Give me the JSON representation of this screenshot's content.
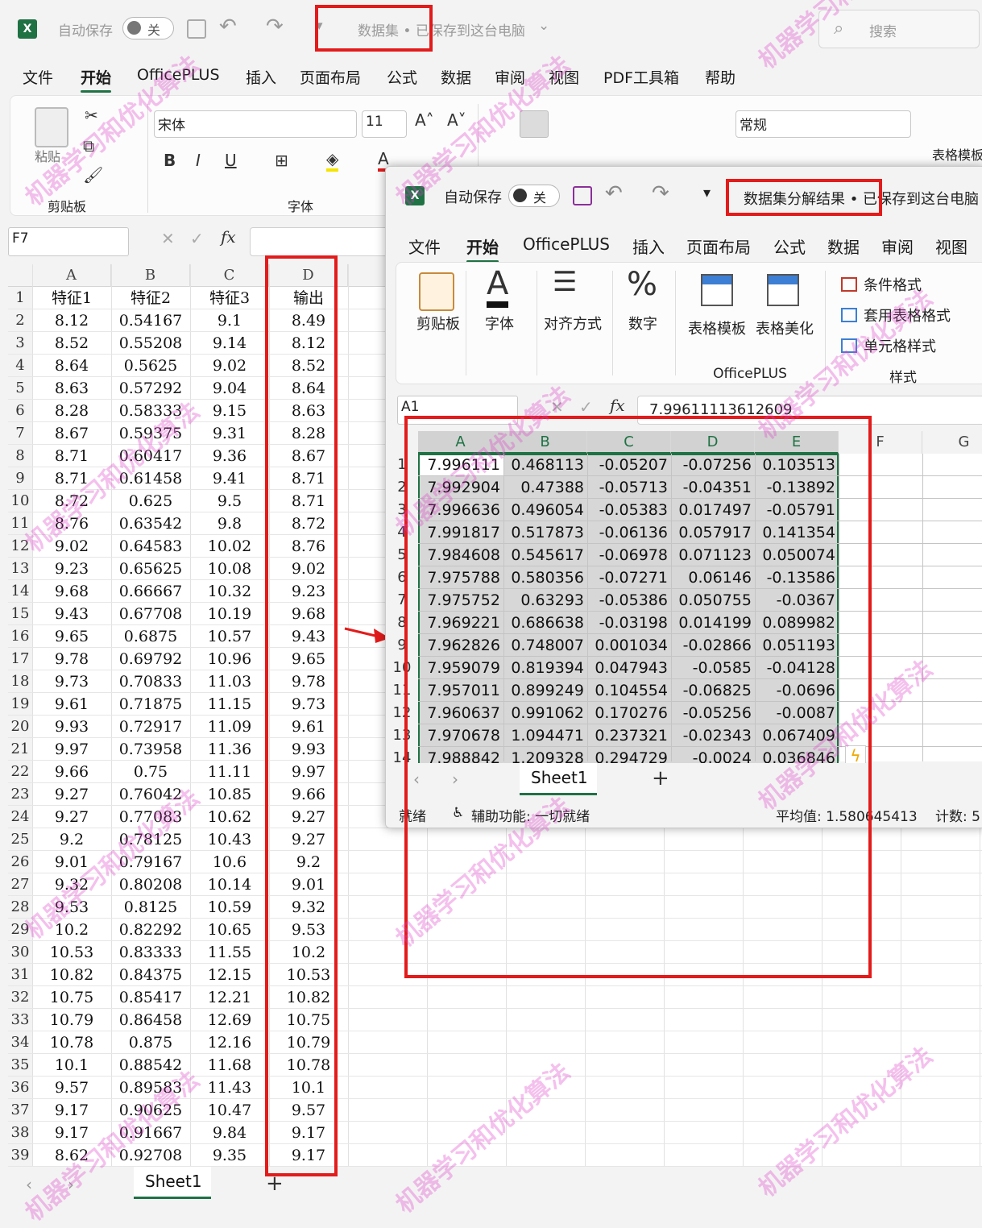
{
  "back": {
    "title": {
      "autosave_label": "自动保存",
      "autosave_state": "关",
      "doc_title": "数据集 • 已保存到这台电脑",
      "search_placeholder": "搜索"
    },
    "menu": [
      "文件",
      "开始",
      "OfficePLUS",
      "插入",
      "页面布局",
      "公式",
      "数据",
      "审阅",
      "视图",
      "PDF工具箱",
      "帮助"
    ],
    "ribbon": {
      "paste_label": "粘贴",
      "clipboard_group": "剪贴板",
      "font_name": "宋体",
      "font_size": "11",
      "font_group": "字体",
      "number_format": "常规",
      "table_template": "表格模板"
    },
    "name_box": "F7",
    "columns": [
      "A",
      "B",
      "C",
      "D"
    ],
    "rows": [
      [
        "特征1",
        "特征2",
        "特征3",
        "输出"
      ],
      [
        "8.12",
        "0.54167",
        "9.1",
        "8.49"
      ],
      [
        "8.52",
        "0.55208",
        "9.14",
        "8.12"
      ],
      [
        "8.64",
        "0.5625",
        "9.02",
        "8.52"
      ],
      [
        "8.63",
        "0.57292",
        "9.04",
        "8.64"
      ],
      [
        "8.28",
        "0.58333",
        "9.15",
        "8.63"
      ],
      [
        "8.67",
        "0.59375",
        "9.31",
        "8.28"
      ],
      [
        "8.71",
        "0.60417",
        "9.36",
        "8.67"
      ],
      [
        "8.71",
        "0.61458",
        "9.41",
        "8.71"
      ],
      [
        "8.72",
        "0.625",
        "9.5",
        "8.71"
      ],
      [
        "8.76",
        "0.63542",
        "9.8",
        "8.72"
      ],
      [
        "9.02",
        "0.64583",
        "10.02",
        "8.76"
      ],
      [
        "9.23",
        "0.65625",
        "10.08",
        "9.02"
      ],
      [
        "9.68",
        "0.66667",
        "10.32",
        "9.23"
      ],
      [
        "9.43",
        "0.67708",
        "10.19",
        "9.68"
      ],
      [
        "9.65",
        "0.6875",
        "10.57",
        "9.43"
      ],
      [
        "9.78",
        "0.69792",
        "10.96",
        "9.65"
      ],
      [
        "9.73",
        "0.70833",
        "11.03",
        "9.78"
      ],
      [
        "9.61",
        "0.71875",
        "11.15",
        "9.73"
      ],
      [
        "9.93",
        "0.72917",
        "11.09",
        "9.61"
      ],
      [
        "9.97",
        "0.73958",
        "11.36",
        "9.93"
      ],
      [
        "9.66",
        "0.75",
        "11.11",
        "9.97"
      ],
      [
        "9.27",
        "0.76042",
        "10.85",
        "9.66"
      ],
      [
        "9.27",
        "0.77083",
        "10.62",
        "9.27"
      ],
      [
        "9.2",
        "0.78125",
        "10.43",
        "9.27"
      ],
      [
        "9.01",
        "0.79167",
        "10.6",
        "9.2"
      ],
      [
        "9.32",
        "0.80208",
        "10.14",
        "9.01"
      ],
      [
        "9.53",
        "0.8125",
        "10.59",
        "9.32"
      ],
      [
        "10.2",
        "0.82292",
        "10.65",
        "9.53"
      ],
      [
        "10.53",
        "0.83333",
        "11.55",
        "10.2"
      ],
      [
        "10.82",
        "0.84375",
        "12.15",
        "10.53"
      ],
      [
        "10.75",
        "0.85417",
        "12.21",
        "10.82"
      ],
      [
        "10.79",
        "0.86458",
        "12.69",
        "10.75"
      ],
      [
        "10.78",
        "0.875",
        "12.16",
        "10.79"
      ],
      [
        "10.1",
        "0.88542",
        "11.68",
        "10.78"
      ],
      [
        "9.57",
        "0.89583",
        "11.43",
        "10.1"
      ],
      [
        "9.17",
        "0.90625",
        "10.47",
        "9.57"
      ],
      [
        "9.17",
        "0.91667",
        "9.84",
        "9.17"
      ],
      [
        "8.62",
        "0.92708",
        "9.35",
        "9.17"
      ]
    ],
    "sheet_tab": "Sheet1",
    "add_sheet": "+"
  },
  "front": {
    "title": {
      "autosave_label": "自动保存",
      "autosave_state": "关",
      "doc_title": "数据集分解结果 • 已保存到这台电脑"
    },
    "menu": [
      "文件",
      "开始",
      "OfficePLUS",
      "插入",
      "页面布局",
      "公式",
      "数据",
      "审阅",
      "视图"
    ],
    "ribbon": {
      "clipboard": "剪贴板",
      "font": "字体",
      "alignment": "对齐方式",
      "number": "数字",
      "table_template": "表格模板",
      "table_beautify": "表格美化",
      "officeplus_group": "OfficePLUS",
      "cond_format": "条件格式",
      "table_format": "套用表格格式",
      "cell_style": "单元格样式",
      "styles_group": "样式"
    },
    "name_box": "A1",
    "formula_value": "7.99611113612609",
    "columns": [
      "A",
      "B",
      "C",
      "D",
      "E",
      "F",
      "G"
    ],
    "rows": [
      [
        "7.996111",
        "0.468113",
        "-0.05207",
        "-0.07256",
        "0.103513"
      ],
      [
        "7.992904",
        "0.47388",
        "-0.05713",
        "-0.04351",
        "-0.13892"
      ],
      [
        "7.996636",
        "0.496054",
        "-0.05383",
        "0.017497",
        "-0.05791"
      ],
      [
        "7.991817",
        "0.517873",
        "-0.06136",
        "0.057917",
        "0.141354"
      ],
      [
        "7.984608",
        "0.545617",
        "-0.06978",
        "0.071123",
        "0.050074"
      ],
      [
        "7.975788",
        "0.580356",
        "-0.07271",
        "0.06146",
        "-0.13586"
      ],
      [
        "7.975752",
        "0.63293",
        "-0.05386",
        "0.050755",
        "-0.0367"
      ],
      [
        "7.969221",
        "0.686638",
        "-0.03198",
        "0.014199",
        "0.089982"
      ],
      [
        "7.962826",
        "0.748007",
        "0.001034",
        "-0.02866",
        "0.051193"
      ],
      [
        "7.959079",
        "0.819394",
        "0.047943",
        "-0.0585",
        "-0.04128"
      ],
      [
        "7.957011",
        "0.899249",
        "0.104554",
        "-0.06825",
        "-0.0696"
      ],
      [
        "7.960637",
        "0.991062",
        "0.170276",
        "-0.05256",
        "-0.0087"
      ],
      [
        "7.970678",
        "1.094471",
        "0.237321",
        "-0.02343",
        "0.067409"
      ],
      [
        "7.988842",
        "1.209328",
        "0.294729",
        "-0.0024",
        "0.036846"
      ]
    ],
    "sheet_tab": "Sheet1",
    "add_sheet": "+",
    "status_ready": "就绪",
    "accessibility": "辅助功能: 一切就绪",
    "average": "平均值: 1.580645413",
    "count": "计数: 5"
  },
  "watermark": "机器学习和优化算法",
  "colors": {
    "excel_green": "#1f7244",
    "highlight_red": "#e31b1b",
    "watermark": "#dc3cc8"
  }
}
